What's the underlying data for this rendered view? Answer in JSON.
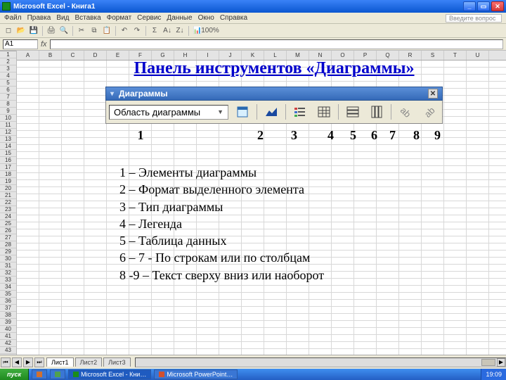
{
  "window": {
    "title": "Microsoft Excel - Книга1"
  },
  "menu": {
    "items": [
      "Файл",
      "Правка",
      "Вид",
      "Вставка",
      "Формат",
      "Сервис",
      "Данные",
      "Окно",
      "Справка"
    ],
    "ask": "Введите вопрос"
  },
  "formula_bar": {
    "name_value": "A1"
  },
  "columns": [
    "A",
    "B",
    "C",
    "D",
    "E",
    "F",
    "G",
    "H",
    "I",
    "J",
    "K",
    "L",
    "M",
    "N",
    "O",
    "P",
    "Q",
    "R",
    "S",
    "T",
    "U"
  ],
  "row_count": 44,
  "slide": {
    "title": "Панель инструментов «Диаграммы»"
  },
  "charts_toolbar": {
    "title": "Диаграммы",
    "selected": "Область диаграммы",
    "numbers": [
      "1",
      "2",
      "3",
      "4",
      "5",
      "6",
      "7",
      "8",
      "9"
    ],
    "descriptions": [
      "1 – Элементы диаграммы",
      "2 – Формат выделенного элемента",
      "3 – Тип диаграммы",
      "4 – Легенда",
      "5 – Таблица данных",
      "6 – 7  - По строкам или по столбцам",
      "8 -9 – Текст сверху вниз или наоборот"
    ]
  },
  "sheets": {
    "tabs": [
      "Лист1",
      "Лист2",
      "Лист3"
    ],
    "active": 0
  },
  "taskbar": {
    "start": "пуск",
    "items": [
      {
        "label": ""
      },
      {
        "label": ""
      },
      {
        "label": "Microsoft Excel - Кни…"
      },
      {
        "label": "Microsoft PowerPoint…"
      }
    ],
    "clock": "19:09"
  }
}
